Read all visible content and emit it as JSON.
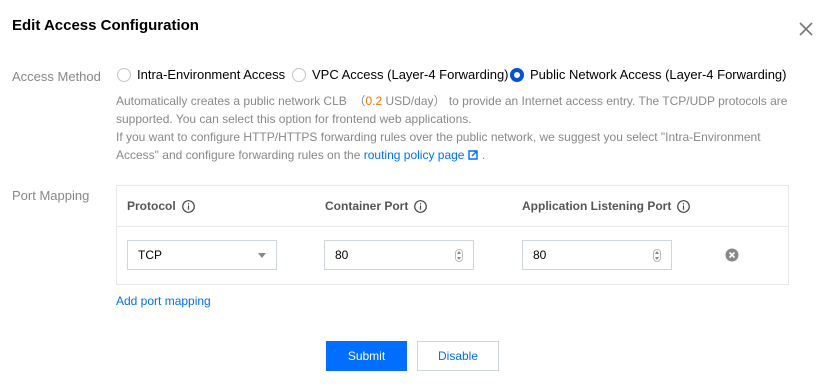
{
  "dialog": {
    "title": "Edit Access Configuration",
    "close_icon": "close-icon"
  },
  "access_method": {
    "label": "Access Method",
    "options": [
      {
        "label": "Intra-Environment Access",
        "selected": false
      },
      {
        "label": "VPC Access (Layer-4 Forwarding)",
        "selected": false
      },
      {
        "label": "Public Network Access (Layer-4 Forwarding)",
        "selected": true
      }
    ],
    "desc_prefix": "Automatically creates a public network CLB  （",
    "desc_price": "0.2",
    "desc_price_unit": " USD/day）",
    "desc_rest": " to provide an Internet access entry. The TCP/UDP protocols are supported. You can select this option for frontend web applications.",
    "desc_line2": "If you want to configure HTTP/HTTPS forwarding rules over the public network, we suggest you select \"Intra-Environment Access\" and configure forwarding rules on the",
    "desc_link": "routing policy page",
    "desc_end": "."
  },
  "port_mapping": {
    "label": "Port Mapping",
    "columns": [
      "Protocol",
      "Container Port",
      "Application Listening Port"
    ],
    "rows": [
      {
        "protocol": "TCP",
        "container_port": "80",
        "listening_port": "80"
      }
    ],
    "add_label": "Add port mapping"
  },
  "footer": {
    "submit_label": "Submit",
    "disable_label": "Disable"
  },
  "colors": {
    "accent": "#006eff",
    "price": "#ff7200"
  }
}
